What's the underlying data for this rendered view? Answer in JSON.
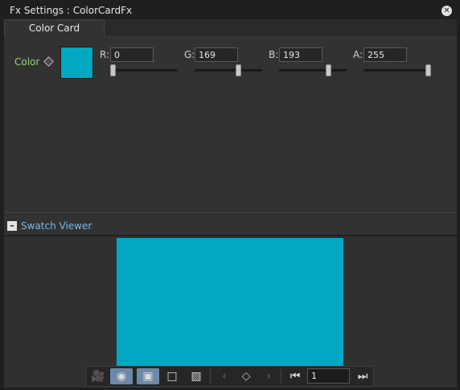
{
  "window": {
    "title": "Fx Settings : ColorCardFx",
    "close_icon": "close-icon"
  },
  "tabs": [
    {
      "label": "Color Card",
      "active": true
    }
  ],
  "color_param": {
    "label": "Color",
    "swatch_color": "#00a9c1",
    "channels": [
      {
        "name": "R:",
        "value": "0",
        "level": 0
      },
      {
        "name": "G:",
        "value": "169",
        "level": 0.663
      },
      {
        "name": "B:",
        "value": "193",
        "level": 0.757
      },
      {
        "name": "A:",
        "value": "255",
        "level": 1
      }
    ]
  },
  "swatch_viewer": {
    "label": "Swatch Viewer",
    "toggle_symbol": "–",
    "preview_color": "#00a9c1"
  },
  "toolbar": {
    "buttons": [
      {
        "name": "camera-icon",
        "glyph": "🎥",
        "active": false
      },
      {
        "name": "eye-icon",
        "glyph": "◉",
        "active": true
      },
      {
        "name": "frame-filled-icon",
        "glyph": "▣",
        "active": true
      },
      {
        "name": "frame-outline-icon",
        "glyph": "□",
        "active": false
      },
      {
        "name": "checker-icon",
        "glyph": "▨",
        "active": false
      }
    ],
    "nav": {
      "prev": "‹",
      "key": "◇",
      "next": "›",
      "first": "⏮",
      "last": "⏭"
    },
    "frame_value": "1"
  },
  "colors": {
    "accent": "#6c8aa8",
    "param_label": "#9fce7a",
    "viewer_label": "#7fb8e6"
  }
}
